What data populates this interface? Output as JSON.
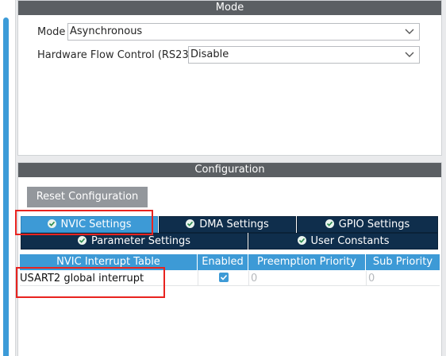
{
  "mode_panel": {
    "header": "Mode",
    "fields": [
      {
        "label": "Mode",
        "value": "Asynchronous"
      },
      {
        "label": "Hardware Flow Control (RS232)",
        "value": "Disable"
      }
    ]
  },
  "config_panel": {
    "header": "Configuration",
    "reset_button": "Reset Configuration",
    "tabs_row1": [
      "NVIC Settings",
      "DMA Settings",
      "GPIO Settings"
    ],
    "tabs_row2": [
      "Parameter Settings",
      "User Constants"
    ],
    "table": {
      "columns": [
        "NVIC Interrupt Table",
        "Enabled",
        "Preemption Priority",
        "Sub Priority"
      ],
      "rows": [
        {
          "name": "USART2 global interrupt",
          "enabled": true,
          "preemption": "0",
          "sub": "0"
        }
      ]
    }
  },
  "colors": {
    "header_gray": "#5b5f63",
    "tab_active": "#3d9ad6",
    "tab_inactive": "#0f2e4c",
    "highlight_red": "#e8231f"
  }
}
